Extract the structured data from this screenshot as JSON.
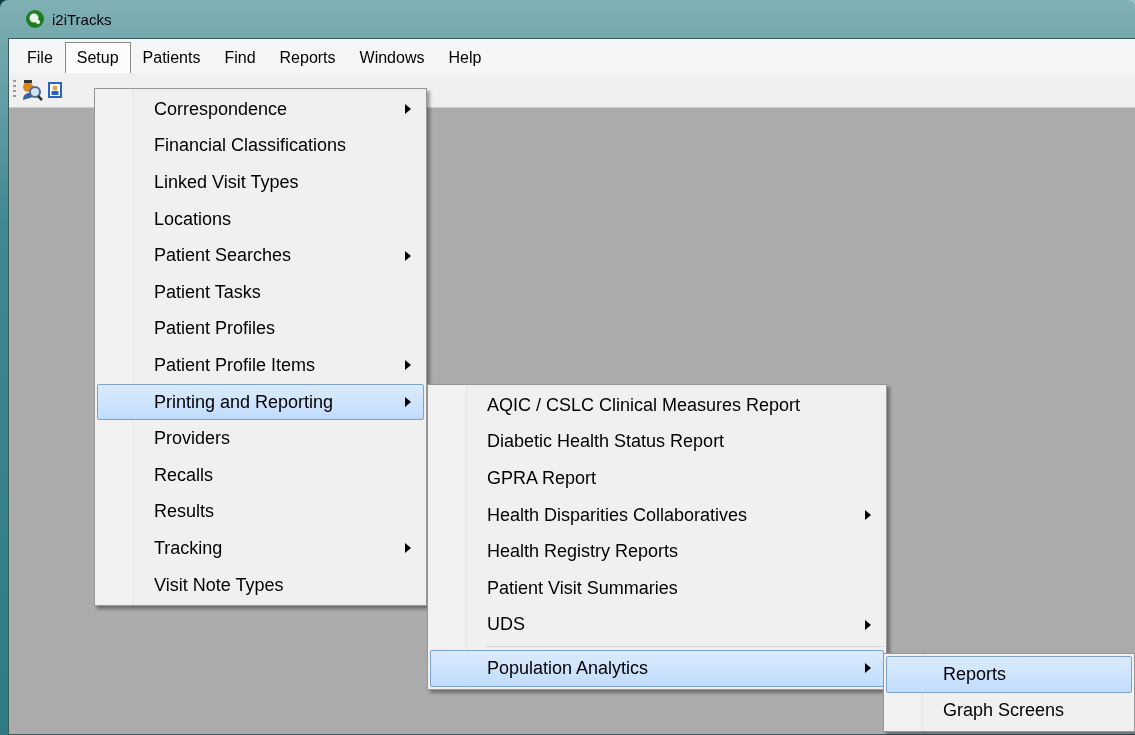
{
  "window": {
    "title": "i2iTracks"
  },
  "menubar": [
    {
      "label": "File",
      "selected": false
    },
    {
      "label": "Setup",
      "selected": true
    },
    {
      "label": "Patients",
      "selected": false
    },
    {
      "label": "Find",
      "selected": false
    },
    {
      "label": "Reports",
      "selected": false
    },
    {
      "label": "Windows",
      "selected": false
    },
    {
      "label": "Help",
      "selected": false
    }
  ],
  "setup_menu": [
    {
      "label": "Correspondence",
      "submenu": true,
      "selected": false
    },
    {
      "label": "Financial Classifications",
      "submenu": false,
      "selected": false
    },
    {
      "label": "Linked Visit Types",
      "submenu": false,
      "selected": false
    },
    {
      "label": "Locations",
      "submenu": false,
      "selected": false
    },
    {
      "label": "Patient Searches",
      "submenu": true,
      "selected": false
    },
    {
      "label": "Patient Tasks",
      "submenu": false,
      "selected": false
    },
    {
      "label": "Patient Profiles",
      "submenu": false,
      "selected": false
    },
    {
      "label": "Patient Profile Items",
      "submenu": true,
      "selected": false
    },
    {
      "label": "Printing and Reporting",
      "submenu": true,
      "selected": true
    },
    {
      "label": "Providers",
      "submenu": false,
      "selected": false
    },
    {
      "label": "Recalls",
      "submenu": false,
      "selected": false
    },
    {
      "label": "Results",
      "submenu": false,
      "selected": false
    },
    {
      "label": "Tracking",
      "submenu": true,
      "selected": false
    },
    {
      "label": "Visit Note Types",
      "submenu": false,
      "selected": false
    }
  ],
  "printing_menu": [
    {
      "label": "AQIC / CSLC Clinical Measures Report",
      "submenu": false,
      "selected": false,
      "separator_before": false
    },
    {
      "label": "Diabetic Health Status Report",
      "submenu": false,
      "selected": false,
      "separator_before": false
    },
    {
      "label": "GPRA Report",
      "submenu": false,
      "selected": false,
      "separator_before": false
    },
    {
      "label": "Health Disparities Collaboratives",
      "submenu": true,
      "selected": false,
      "separator_before": false
    },
    {
      "label": "Health Registry Reports",
      "submenu": false,
      "selected": false,
      "separator_before": false
    },
    {
      "label": "Patient Visit Summaries",
      "submenu": false,
      "selected": false,
      "separator_before": false
    },
    {
      "label": "UDS",
      "submenu": true,
      "selected": false,
      "separator_before": false
    },
    {
      "label": "Population Analytics",
      "submenu": true,
      "selected": true,
      "separator_before": true
    }
  ],
  "analytics_menu": [
    {
      "label": "Reports",
      "submenu": false,
      "selected": true
    },
    {
      "label": "Graph Screens",
      "submenu": false,
      "selected": false
    }
  ]
}
